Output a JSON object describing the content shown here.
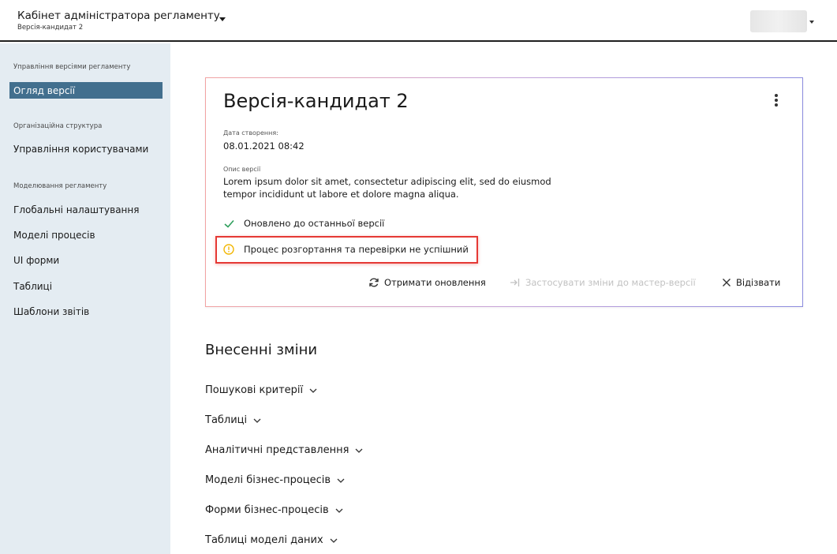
{
  "header": {
    "app_title": "Кабінет адміністратора регламенту",
    "app_subtitle": "Версія-кандидат 2"
  },
  "sidebar": {
    "sections": [
      {
        "title": "Управління версіями регламенту",
        "items": [
          "Огляд версії"
        ]
      },
      {
        "title": "Організаційна структура",
        "items": [
          "Управління користувачами"
        ]
      },
      {
        "title": "Моделювання регламенту",
        "items": [
          "Глобальні налаштування",
          "Моделі процесів",
          "UI форми",
          "Таблиці",
          "Шаблони звітів"
        ]
      }
    ],
    "active_item": "Огляд версії"
  },
  "card": {
    "title": "Версія-кандидат 2",
    "created_label": "Дата створення:",
    "created_value": "08.01.2021 08:42",
    "description_label": "Опис версії",
    "description_line1": "Lorem ipsum dolor sit amet, consectetur adipiscing elit, sed do eiusmod",
    "description_line2": "tempor incididunt ut labore et dolore magna aliqua.",
    "status_ok": "Оновлено до останньої версії",
    "status_warning": "Процес розгортання та перевірки не успішний",
    "actions": {
      "refresh": "Отримати оновлення",
      "apply": "Застосувати зміни до мастер-версії",
      "revoke": "Відізвати"
    },
    "colors": {
      "ok": "#2e9e5b",
      "warning": "#f2b705",
      "highlight": "#e53935"
    }
  },
  "changes": {
    "title": "Внесенні зміни",
    "items": [
      "Пошукові критерії",
      "Таблиці",
      "Аналітичні представлення",
      "Моделі бізнес-процесів",
      "Форми бізнес-процесів",
      "Таблиці моделі даних"
    ]
  }
}
